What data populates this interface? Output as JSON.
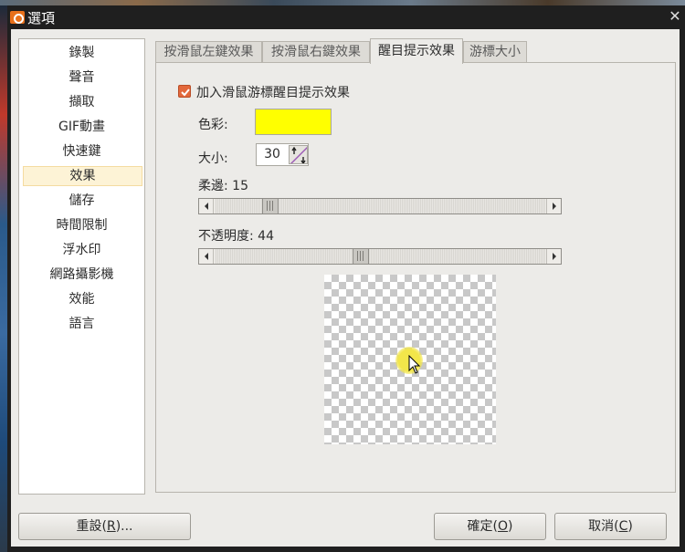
{
  "window": {
    "title": "選項",
    "close_glyph": "✕"
  },
  "sidebar": {
    "items": [
      {
        "label": "錄製"
      },
      {
        "label": "聲音"
      },
      {
        "label": "擷取"
      },
      {
        "label": "GIF動畫"
      },
      {
        "label": "快速鍵"
      },
      {
        "label": "效果",
        "selected": true
      },
      {
        "label": "儲存"
      },
      {
        "label": "時間限制"
      },
      {
        "label": "浮水印"
      },
      {
        "label": "網路攝影機"
      },
      {
        "label": "效能"
      },
      {
        "label": "語言"
      }
    ]
  },
  "tabs": [
    {
      "label": "按滑鼠左鍵效果"
    },
    {
      "label": "按滑鼠右鍵效果"
    },
    {
      "label": "醒目提示效果",
      "active": true
    },
    {
      "label": "游標大小"
    }
  ],
  "highlight": {
    "enabled_label": "加入滑鼠游標醒目提示效果",
    "enabled": true,
    "color_label": "色彩:",
    "color_value": "#ffff00",
    "size_label": "大小:",
    "size_value": "30",
    "softness": {
      "label_prefix": "柔邊: ",
      "value": "15",
      "level": 15,
      "max": 100
    },
    "opacity": {
      "label_prefix": "不透明度: ",
      "value": "44",
      "level": 44,
      "max": 100
    }
  },
  "buttons": {
    "reset": {
      "main": "重設(",
      "mnemonic": "R",
      "tail": ")..."
    },
    "ok": {
      "main": "確定(",
      "mnemonic": "O",
      "tail": ")"
    },
    "cancel": {
      "main": "取消(",
      "mnemonic": "C",
      "tail": ")"
    }
  },
  "colors": {
    "accent": "#e3683b",
    "selected_item_bg": "#fdf3d6",
    "glow": "#f2e64a"
  }
}
